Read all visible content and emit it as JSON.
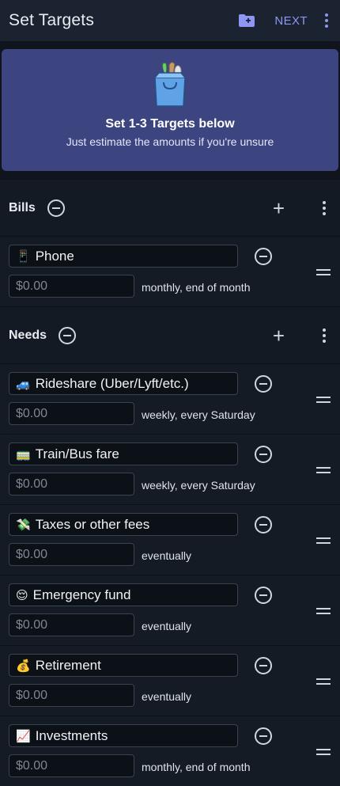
{
  "appbar": {
    "title": "Set Targets",
    "next_label": "NEXT"
  },
  "banner": {
    "headline": "Set 1-3 Targets below",
    "subtext": "Just estimate the amounts if you're unsure"
  },
  "sections": [
    {
      "name": "Bills",
      "items": [
        {
          "emoji": "📱",
          "name": "Phone",
          "amount": "$0.00",
          "schedule": "monthly, end of month"
        }
      ]
    },
    {
      "name": "Needs",
      "items": [
        {
          "emoji": "🚙",
          "name": "Rideshare (Uber/Lyft/etc.)",
          "amount": "$0.00",
          "schedule": "weekly, every Saturday"
        },
        {
          "emoji": "🚃",
          "name": "Train/Bus fare",
          "amount": "$0.00",
          "schedule": "weekly, every Saturday"
        },
        {
          "emoji": "💸",
          "name": "Taxes or other fees",
          "amount": "$0.00",
          "schedule": "eventually"
        },
        {
          "emoji": "😌",
          "name": "Emergency fund",
          "amount": "$0.00",
          "schedule": "eventually"
        },
        {
          "emoji": "💰",
          "name": "Retirement",
          "amount": "$0.00",
          "schedule": "eventually"
        },
        {
          "emoji": "📈",
          "name": "Investments",
          "amount": "$0.00",
          "schedule": "monthly, end of month"
        }
      ]
    }
  ],
  "icons": {
    "folder": "folder-add-icon",
    "menu": "more-vert-icon",
    "bag": "grocery-bag-icon",
    "remove": "remove-circle-icon",
    "add": "add-icon",
    "drag": "drag-handle-icon"
  },
  "colors": {
    "accent": "#8e97f3",
    "banner": "#3d4580",
    "background": "#10151d"
  }
}
